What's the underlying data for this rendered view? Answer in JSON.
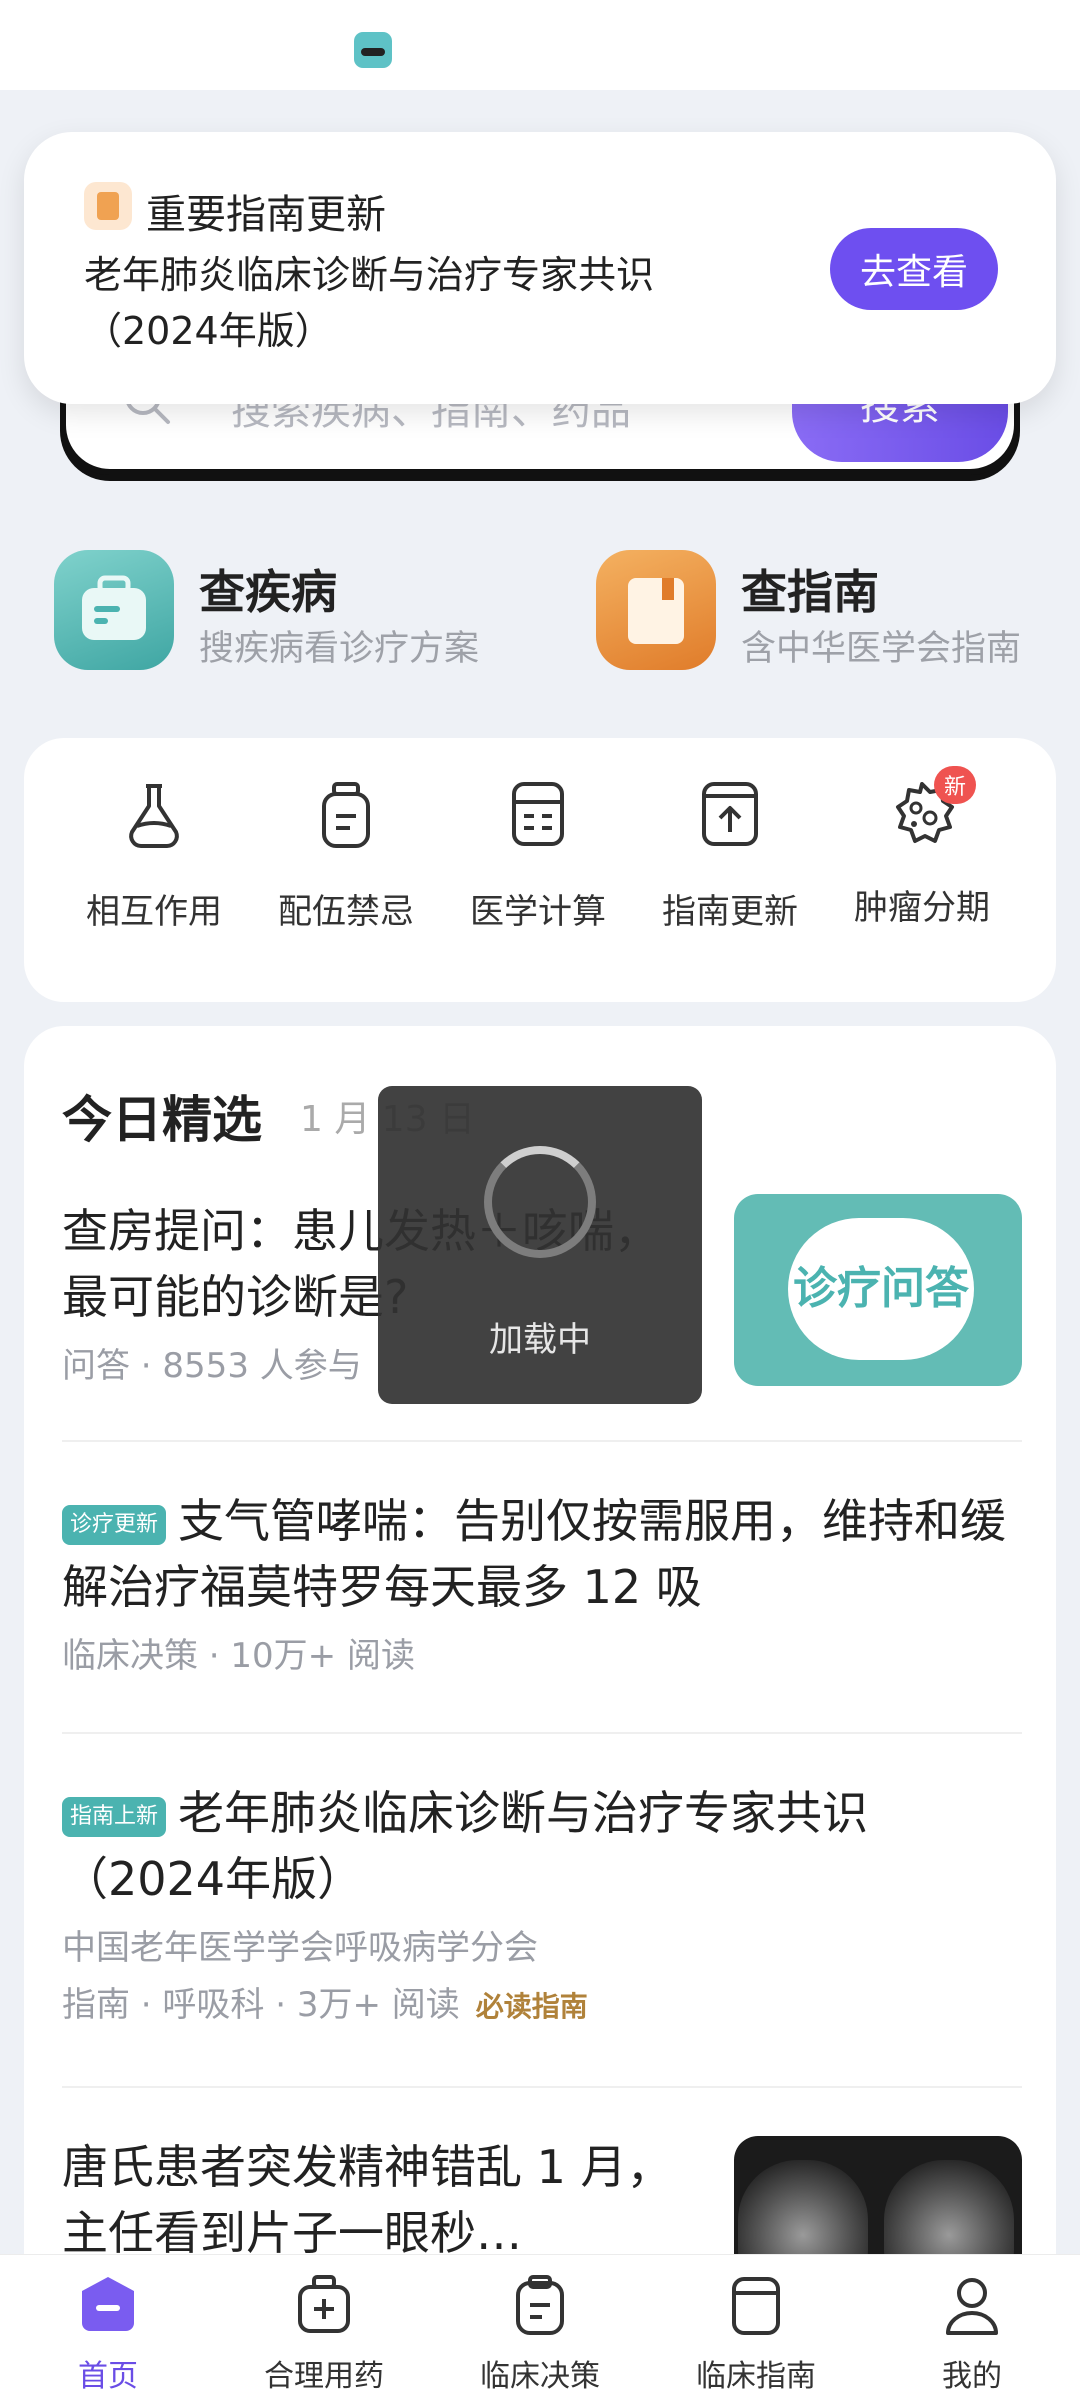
{
  "search": {
    "placeholder": "搜索疾病、指南、药品",
    "button_label": "搜索"
  },
  "notification": {
    "title": "重要指南更新",
    "body": "老年肺炎临床诊断与治疗专家共识（2024年版）",
    "action_label": "去查看"
  },
  "shortcuts": [
    {
      "title": "查疾病",
      "subtitle": "搜疾病看诊疗方案"
    },
    {
      "title": "查指南",
      "subtitle": "含中华医学会指南"
    }
  ],
  "tools": [
    {
      "label": "相互作用",
      "icon": "flask-icon"
    },
    {
      "label": "配伍禁忌",
      "icon": "bottle-icon"
    },
    {
      "label": "医学计算",
      "icon": "calculator-icon"
    },
    {
      "label": "指南更新",
      "icon": "upload-icon"
    },
    {
      "label": "肿瘤分期",
      "icon": "cell-icon",
      "badge": "新"
    }
  ],
  "feed": {
    "heading": "今日精选",
    "date": "1 月 13 日",
    "articles": [
      {
        "title": "查房提问：患儿发热＋咳喘，最可能的诊断是?",
        "meta": "问答 · 8553 人参与",
        "thumb_text": "诊疗问答"
      },
      {
        "tag": "诊疗更新",
        "title": "支气管哮喘：告别仅按需服用，维持和缓解治疗福莫特罗每天最多 12 吸",
        "meta": "临床决策 · 10万+ 阅读"
      },
      {
        "tag": "指南上新",
        "title": "老年肺炎临床诊断与治疗专家共识（2024年版）",
        "org": "中国老年医学学会呼吸病学分会",
        "meta": "指南 · 呼吸科 · 3万+ 阅读",
        "badge": "必读指南"
      },
      {
        "title": "唐氏患者突发精神错乱 1 月，主任看到片子一眼秒…"
      }
    ]
  },
  "loading": {
    "text": "加载中"
  },
  "nav": [
    {
      "label": "首页",
      "icon": "home-icon",
      "active": true
    },
    {
      "label": "合理用药",
      "icon": "medicine-bag-icon"
    },
    {
      "label": "临床决策",
      "icon": "clipboard-icon"
    },
    {
      "label": "临床指南",
      "icon": "book-icon"
    },
    {
      "label": "我的",
      "icon": "profile-icon"
    }
  ],
  "colors": {
    "accent": "#6e4ff0",
    "teal": "#4bb3b0",
    "orange": "#e07c2a",
    "badge_red": "#ef5350"
  }
}
